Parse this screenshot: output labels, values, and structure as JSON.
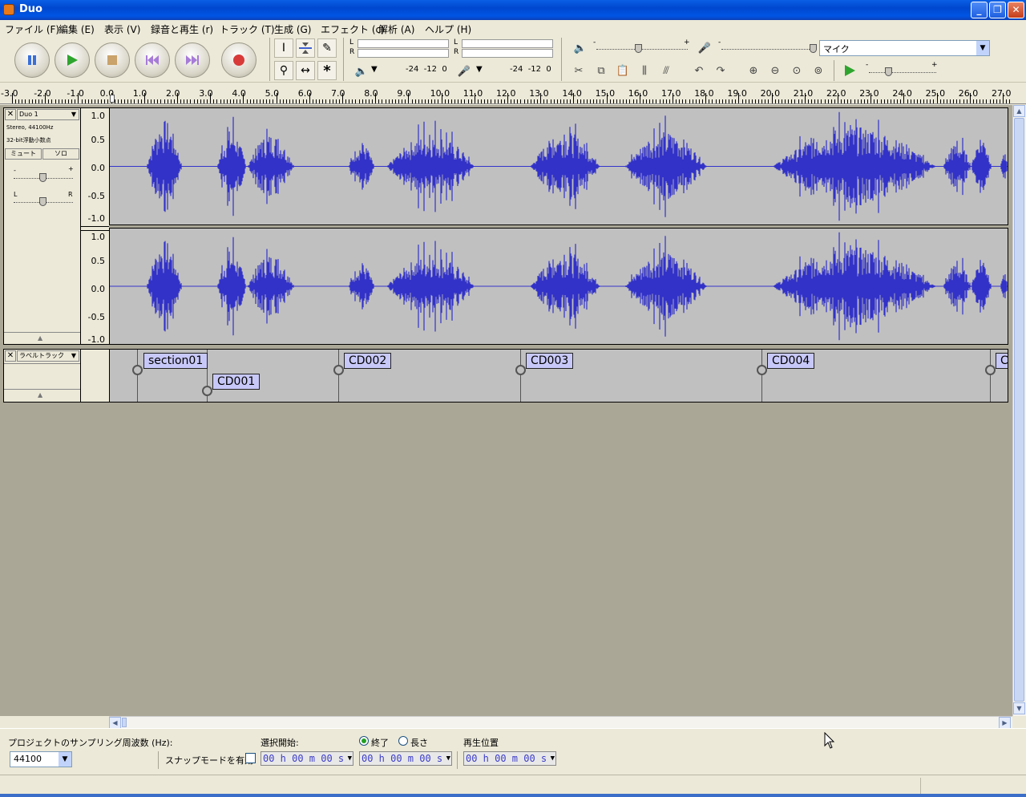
{
  "window": {
    "title": "Duo",
    "minimize": "_",
    "maximize": "❐",
    "close": "✕"
  },
  "menu": [
    {
      "label": "ファイル (F)"
    },
    {
      "label": "編集 (E)"
    },
    {
      "label": "表示 (V)"
    },
    {
      "label": "録音と再生 (r)"
    },
    {
      "label": "トラック (T)"
    },
    {
      "label": "生成 (G)"
    },
    {
      "label": "エフェクト (c)"
    },
    {
      "label": "解析 (A)"
    },
    {
      "label": "ヘルプ (H)"
    }
  ],
  "transport": {
    "pause_icon": "pause-icon",
    "play_icon": "play-icon",
    "stop_icon": "stop-icon",
    "rewind_icon": "skip-start-icon",
    "ffwd_icon": "skip-end-icon",
    "record_icon": "record-icon"
  },
  "meters": {
    "L": "L",
    "R": "R",
    "scale_play": "-24  -12  0",
    "scale_rec": "-24  -12  0"
  },
  "input_device": "マイク",
  "ruler": {
    "labels": [
      "-3.0",
      "-2.0",
      "-1.0",
      "0.0",
      "1.0",
      "2.0",
      "3.0",
      "4.0",
      "5.0",
      "6.0",
      "7.0",
      "8.0",
      "9.0",
      "10.0",
      "11.0",
      "12.0",
      "13.0",
      "14.0",
      "15.0",
      "16.0",
      "17.0",
      "18.0",
      "19.0",
      "20.0",
      "21.0",
      "22.0",
      "23.0",
      "24.0",
      "25.0",
      "26.0",
      "27.0"
    ]
  },
  "audio_track": {
    "name": "Duo 1",
    "info1": "Stereo, 44100Hz",
    "info2": "32-bit浮動小数点",
    "mute": "ミュート",
    "solo": "ソロ",
    "gain_minus": "-",
    "gain_plus": "+",
    "pan_l": "L",
    "pan_r": "R",
    "scale": [
      "1.0",
      "0.5",
      "0.0",
      "-0.5",
      "-1.0"
    ]
  },
  "label_track": {
    "name": "ラベルトラック",
    "labels": [
      {
        "text": "section01"
      },
      {
        "text": "CD001"
      },
      {
        "text": "CD002"
      },
      {
        "text": "CD003"
      },
      {
        "text": "CD004"
      },
      {
        "text": "C"
      }
    ]
  },
  "selection_bar": {
    "rate_label": "プロジェクトのサンプリング周波数 (Hz):",
    "rate_value": "44100",
    "snap_label": "スナップモードを有効",
    "sel_start_label": "選択開始:",
    "end_label": "終了",
    "length_label": "長さ",
    "position_label": "再生位置",
    "time_zero": "00 h 00 m 00 s"
  }
}
